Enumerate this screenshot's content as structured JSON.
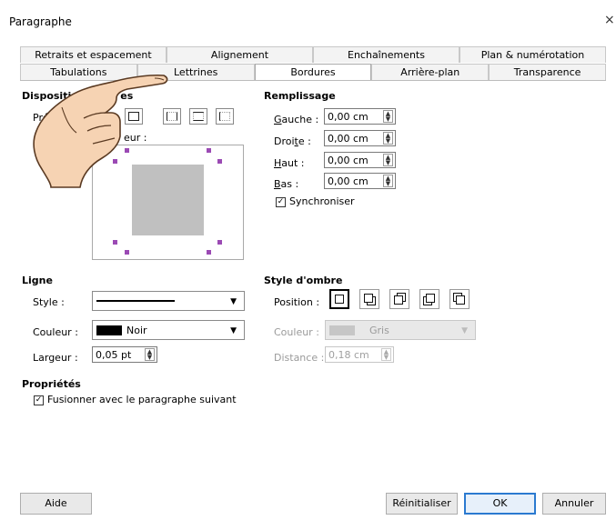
{
  "window": {
    "title": "Paragraphe",
    "close_glyph": "×"
  },
  "tabs": {
    "row1": [
      "Retraits et espacement",
      "Alignement",
      "Enchaînements",
      "Plan & numérotation"
    ],
    "row2": [
      "Tabulations",
      "Lettrines",
      "Bordures",
      "Arrière-plan",
      "Transparence"
    ],
    "active": "Bordures"
  },
  "disposition": {
    "heading": "Dispositi",
    "heading_end": "es",
    "preset_label_start": "Pré",
    "user_label_end": "eur :"
  },
  "remplissage": {
    "heading": "Remplissage",
    "fields": [
      {
        "label_pre": "",
        "label_u": "G",
        "label_post": "auche :",
        "value": "0,00 cm"
      },
      {
        "label_pre": "Droi",
        "label_u": "t",
        "label_post": "e :",
        "value": "0,00 cm"
      },
      {
        "label_pre": "",
        "label_u": "H",
        "label_post": "aut :",
        "value": "0,00 cm"
      },
      {
        "label_pre": "",
        "label_u": "B",
        "label_post": "as :",
        "value": "0,00 cm"
      }
    ],
    "sync_label": "Synchroniser",
    "sync_checked": true
  },
  "ligne": {
    "heading": "Ligne",
    "style_label": "Style :",
    "color_label": "Couleur :",
    "color_value": "Noir",
    "width_label": "Largeur :",
    "width_value": "0,05 pt"
  },
  "ombre": {
    "heading": "Style d'ombre",
    "position_label": "Position :",
    "color_label": "Couleur :",
    "color_value": "Gris",
    "distance_label": "Distance :",
    "distance_value": "0,18 cm"
  },
  "proprietes": {
    "heading": "Propriétés",
    "merge_label": "Fusionner avec le paragraphe suivant",
    "merge_checked": true
  },
  "buttons": {
    "help": "Aide",
    "reset": "Réinitialiser",
    "ok": "OK",
    "cancel": "Annuler"
  },
  "colors": {
    "accent": "#2b7ad0",
    "preview_fill": "#c0c0c0",
    "handle": "#9b4ab4"
  }
}
